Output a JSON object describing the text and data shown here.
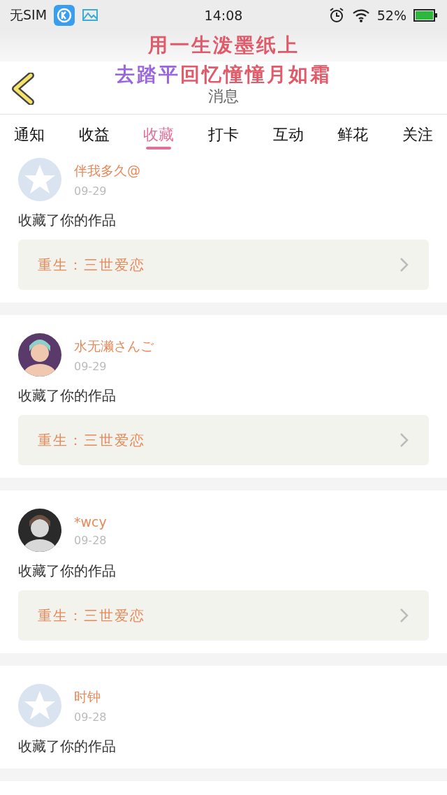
{
  "status_bar": {
    "carrier": "无SIM",
    "time": "14:08",
    "battery": "52%"
  },
  "overlay_text": [
    [
      {
        "text": "用一生泼墨纸上",
        "color": "#e05a6a"
      }
    ],
    [
      {
        "text": "去踏平",
        "color": "#9a66e0"
      },
      {
        "text": "回忆憧憧月如霜",
        "color": "#e05a6a"
      }
    ]
  ],
  "header": {
    "title": "消息"
  },
  "tabs": [
    {
      "label": "通知",
      "selected": false
    },
    {
      "label": "收益",
      "selected": false
    },
    {
      "label": "收藏",
      "selected": true
    },
    {
      "label": "打卡",
      "selected": false
    },
    {
      "label": "互动",
      "selected": false
    },
    {
      "label": "鲜花",
      "selected": false
    },
    {
      "label": "关注",
      "selected": false
    }
  ],
  "messages": [
    {
      "avatar": {
        "kind": "default"
      },
      "name": "伴我多久@",
      "date": "09-29",
      "text": "收藏了你的作品",
      "work": "重生：三世爱恋"
    },
    {
      "name": "水无濑さんご",
      "date": "09-29",
      "text": "收藏了你的作品",
      "work": "重生：三世爱恋"
    },
    {
      "name": "*wcy",
      "date": "09-28",
      "text": "收藏了你的作品",
      "work": "重生：三世爱恋"
    },
    {
      "avatar": {
        "kind": "default"
      },
      "name": "时钟",
      "date": "09-28",
      "text": "收藏了你的作品"
    }
  ]
}
